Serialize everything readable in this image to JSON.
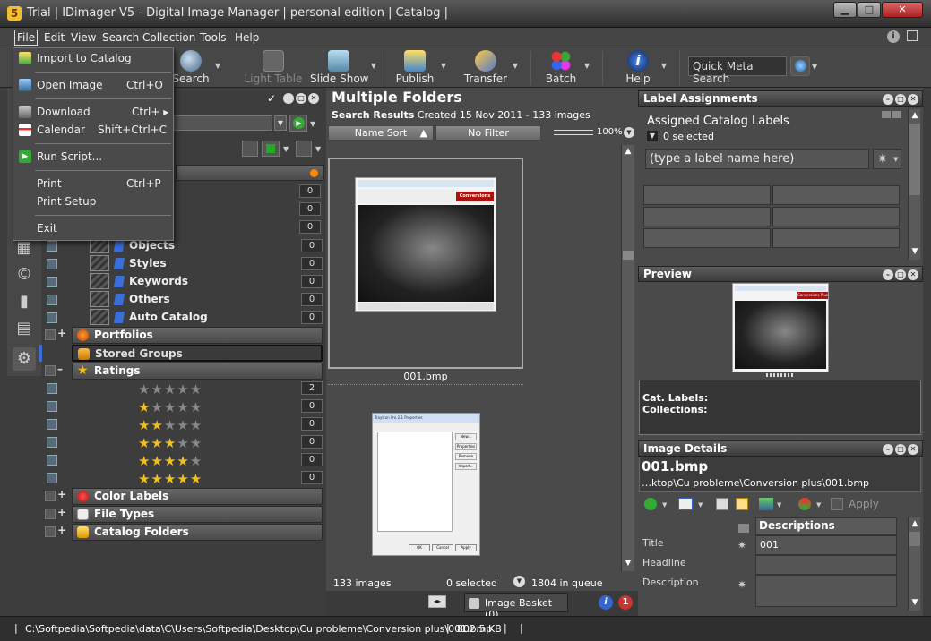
{
  "window": {
    "title": "Trial | IDimager V5 - Digital Image Manager | personal edition | Catalog |",
    "app_icon_letter": "5"
  },
  "menubar": [
    "File",
    "Edit",
    "View",
    "Search",
    "Collection",
    "Tools",
    "Help"
  ],
  "file_menu": [
    {
      "label": "Import to Catalog",
      "shortcut": "",
      "icon": "import-icon"
    },
    {
      "label": "Open Image",
      "shortcut": "Ctrl+O",
      "icon": "open-image-icon"
    },
    {
      "label": "Download",
      "shortcut": "Ctrl+ ▸",
      "icon": "download-icon"
    },
    {
      "label": "Calendar",
      "shortcut": "Shift+Ctrl+C",
      "icon": "calendar-icon"
    },
    {
      "label": "Run Script...",
      "shortcut": "",
      "icon": "run-script-icon"
    },
    {
      "label": "Print",
      "shortcut": "Ctrl+P",
      "icon": ""
    },
    {
      "label": "Print Setup",
      "shortcut": "",
      "icon": ""
    },
    {
      "label": "Exit",
      "shortcut": "",
      "icon": ""
    }
  ],
  "toolbar": {
    "search": "Search",
    "light_table": "Light Table",
    "slide_show": "Slide Show",
    "publish": "Publish",
    "transfer": "Transfer",
    "batch": "Batch",
    "help": "Help",
    "quick_meta_search": "Quick Meta Search"
  },
  "left_panel": {
    "catalog_items": [
      {
        "label": "Objects",
        "count": "0"
      },
      {
        "label": "Styles",
        "count": "0"
      },
      {
        "label": "Keywords",
        "count": "0"
      },
      {
        "label": "Others",
        "count": "0"
      },
      {
        "label": "Auto Catalog",
        "count": "0"
      }
    ],
    "hidden_counts": [
      "0",
      "0",
      "0"
    ],
    "portfolios": "Portfolios",
    "stored_groups": "Stored Groups",
    "ratings": "Ratings",
    "rating_counts": [
      {
        "stars": 0,
        "count": "2"
      },
      {
        "stars": 1,
        "count": "0"
      },
      {
        "stars": 2,
        "count": "0"
      },
      {
        "stars": 3,
        "count": "0"
      },
      {
        "stars": 4,
        "count": "0"
      },
      {
        "stars": 5,
        "count": "0"
      }
    ],
    "color_labels": "Color Labels",
    "file_types": "File Types",
    "catalog_folders": "Catalog Folders"
  },
  "center": {
    "title": "Multiple Folders",
    "search_results": "Search Results",
    "created": "Created 15 Nov 2011  -  133 images",
    "name_sort": "Name Sort",
    "no_filter": "No Filter",
    "zoom": "100%",
    "thumb1_name": "001.bmp",
    "thumb1_label": "Conversions Plus",
    "status_images": "133 images",
    "status_selected": "0 selected",
    "status_queue": "1804 in queue",
    "image_basket": "Image Basket (0)",
    "thumb2_title": "TrayIcon Pro 2.1 Properties",
    "thumb2_buttons": [
      "New...",
      "Properties",
      "Remove",
      "Import..."
    ],
    "thumb2_ok": "OK",
    "thumb2_cancel": "Cancel",
    "thumb2_apply": "Apply"
  },
  "right_panel": {
    "label_assignments": "Label Assignments",
    "assigned_catalog_labels": "Assigned Catalog Labels",
    "selected": "0 selected",
    "label_input_placeholder": "(type a label name here)",
    "preview": "Preview",
    "preview_label": "Conversions Plus",
    "cat_labels": "Cat. Labels:",
    "collections": "Collections:",
    "image_details": "Image Details",
    "filename": "001.bmp",
    "path": "…ktop\\Cu probleme\\Conversion plus\\001.bmp",
    "apply": "Apply",
    "descriptions": "Descriptions",
    "title_label": "Title",
    "title_value": "001",
    "headline_label": "Headline",
    "description_label": "Description"
  },
  "statusbar": {
    "path": "C:\\Softpedia\\Softpedia\\data\\C\\Users\\Softpedia\\Desktop\\Cu probleme\\Conversion plus\\001.bmp",
    "size": "802.5 KB"
  },
  "colors": {
    "accent_blue": "#3a6fd8",
    "star": "#f0c020",
    "background": "#3d3d3d"
  }
}
